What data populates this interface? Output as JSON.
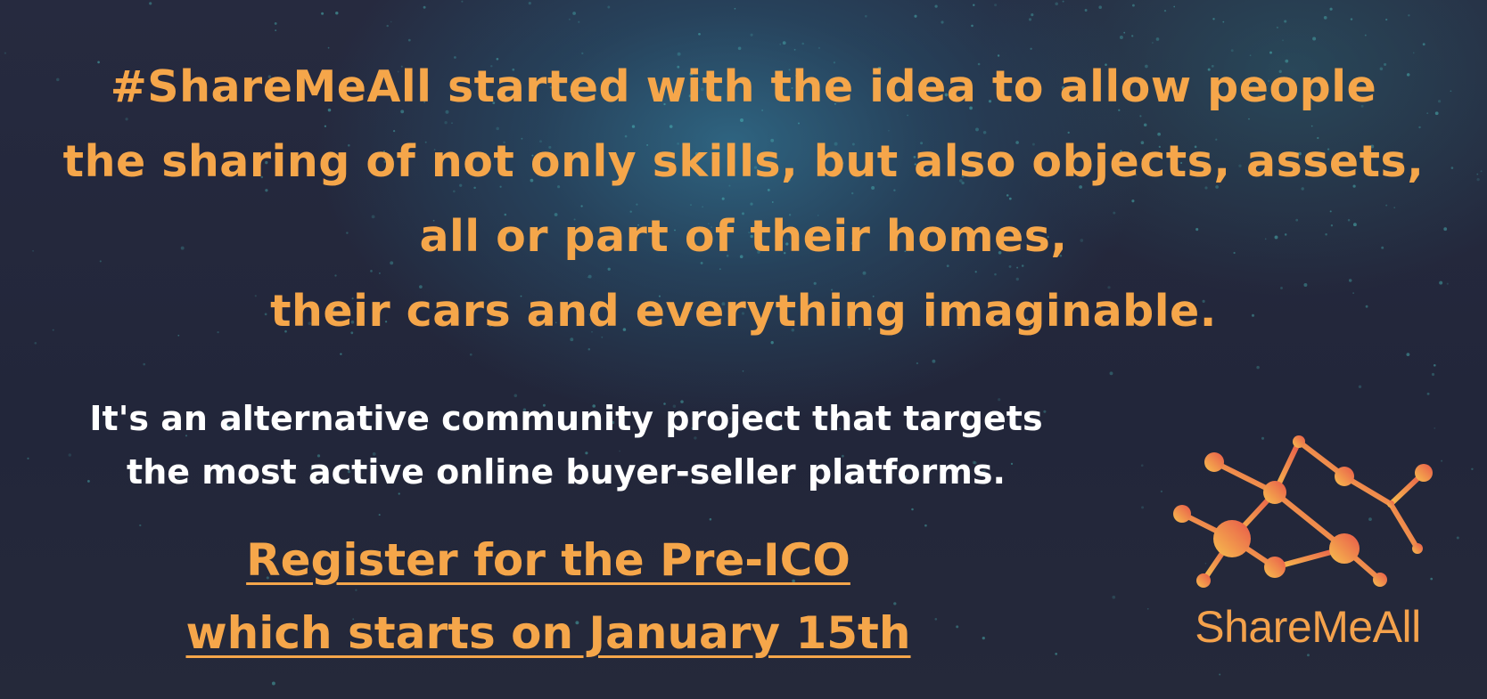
{
  "headline": {
    "lines": [
      "#ShareMeAll started with the idea to allow people",
      "the sharing of not only skills, but also objects, assets,",
      "all or part of their homes,",
      "their cars and everything imaginable."
    ]
  },
  "subtext": {
    "lines": [
      "It's an alternative community project that targets",
      "the most active online buyer-seller platforms."
    ]
  },
  "cta": {
    "lines": [
      "Register for the Pre-ICO ",
      "which starts on January 15th"
    ]
  },
  "logo": {
    "text": "ShareMeAll",
    "icon": "network-nodes-icon"
  },
  "colors": {
    "accent": "#f5a64a",
    "logo_gradient_start": "#f7c04e",
    "logo_gradient_end": "#e8584a",
    "body_text": "#ffffff",
    "background": "#23273a",
    "glow": "#306e8c"
  }
}
